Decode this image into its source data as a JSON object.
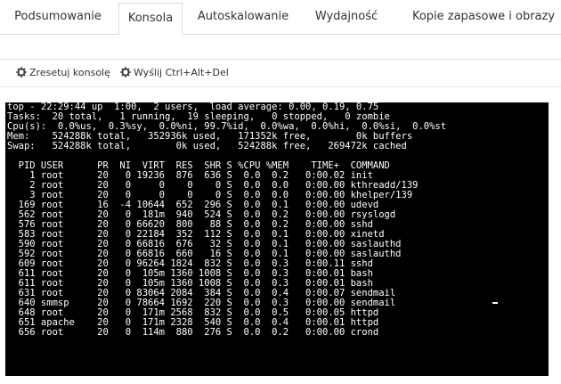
{
  "tabs": [
    {
      "label": "Podsumowanie"
    },
    {
      "label": "Konsola"
    },
    {
      "label": "Autoskalowanie"
    },
    {
      "label": "Wydajność"
    },
    {
      "label": "Kopie zapasowe i obrazy"
    }
  ],
  "toolbar": {
    "reset_label": "Zresetuj konsolę",
    "send_label": "Wyślij Ctrl+Alt+Del"
  },
  "console": {
    "header_lines": [
      "top - 22:29:44 up  1:00,  2 users,  load average: 0.00, 0.19, 0.75",
      "Tasks:  20 total,   1 running,  19 sleeping,   0 stopped,   0 zombie",
      "Cpu(s):  0.0%us,  0.3%sy,  0.0%ni, 99.7%id,  0.0%wa,  0.0%hi,  0.0%si,  0.0%st",
      "Mem:    524288k total,   352936k used,   171352k free,        0k buffers",
      "Swap:   524288k total,        0k used,   524288k free,   269472k cached"
    ],
    "column_header": "  PID USER      PR  NI  VIRT  RES  SHR S %CPU %MEM    TIME+  COMMAND",
    "processes": [
      "    1 root      20   0 19236  876  636 S  0.0  0.2   0:00.02 init",
      "    2 root      20   0     0    0    0 S  0.0  0.0   0:00.00 kthreadd/139",
      "    3 root      20   0     0    0    0 S  0.0  0.0   0:00.00 khelper/139",
      "  169 root      16  -4 10644  652  296 S  0.0  0.1   0:00.00 udevd",
      "  562 root      20   0  181m  940  524 S  0.0  0.2   0:00.00 rsyslogd",
      "  576 root      20   0 66620  800   88 S  0.0  0.2   0:00.00 sshd",
      "  583 root      20   0 22184  352  112 S  0.0  0.1   0:00.00 xinetd",
      "  590 root      20   0 66816  676   32 S  0.0  0.1   0:00.00 saslauthd",
      "  592 root      20   0 66816  660   16 S  0.0  0.1   0:00.00 saslauthd",
      "  609 root      20   0 96264 1824  832 S  0.0  0.3   0:00.11 sshd",
      "  611 root      20   0  105m 1360 1008 S  0.0  0.3   0:00.01 bash",
      "  611 root      20   0  105m 1360 1008 S  0.0  0.3   0:00.01 bash",
      "  631 root      20   0 83064 2084  384 S  0.0  0.4   0:00.07 sendmail",
      "  640 smmsp     20   0 78664 1692  220 S  0.0  0.3   0:00.00 sendmail",
      "  648 root      20   0  171m 2568  832 S  0.0  0.5   0:00.05 httpd",
      "  651 apache    20   0  171m 2328  540 S  0.0  0.4   0:00.01 httpd",
      "  656 root      20   0  114m  880  276 S  0.0  0.2   0:00.00 crond"
    ]
  }
}
